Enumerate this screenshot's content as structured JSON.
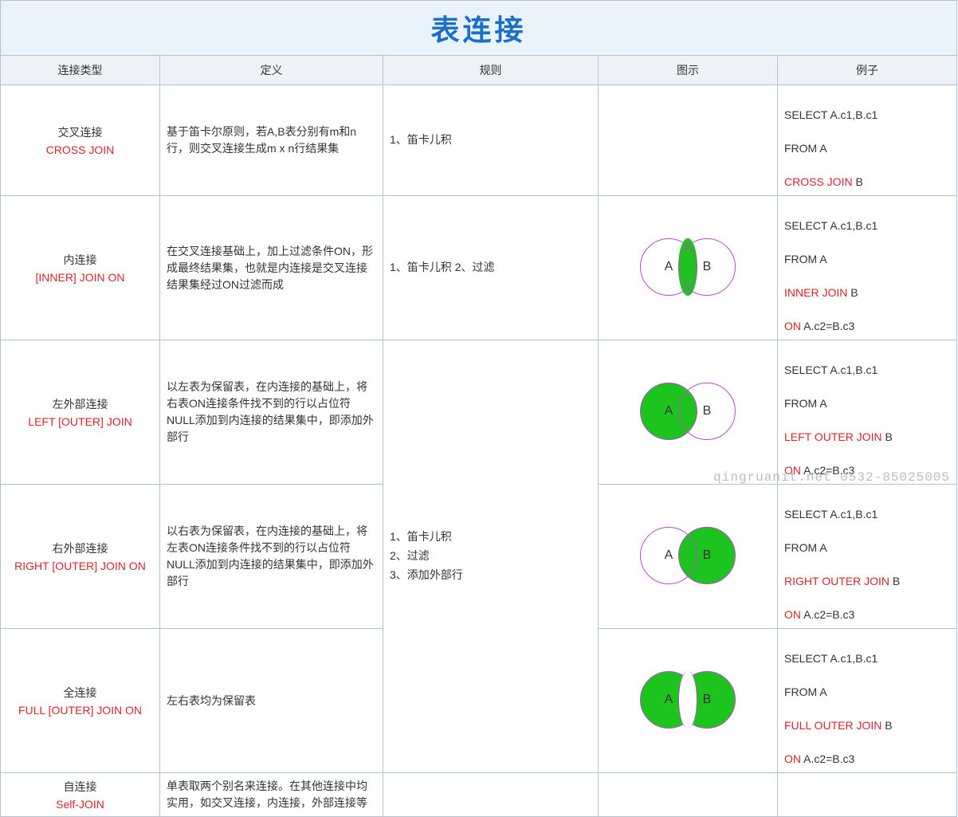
{
  "title": "表连接",
  "headers": {
    "type": "连接类型",
    "def": "定义",
    "rule": "规则",
    "venn": "图示",
    "ex": "例子"
  },
  "rows": {
    "cross": {
      "name_cn": "交叉连接",
      "name_en": "CROSS JOIN",
      "def": "基于笛卡尔原则，若A,B表分别有m和n行，则交叉连接生成m x n行结果集",
      "rule": "1、笛卡儿积",
      "ex_l1": "SELECT A.c1,B.c1",
      "ex_l2": "FROM  A",
      "ex_kw": "CROSS   JOIN",
      "ex_after_kw": " B"
    },
    "inner": {
      "name_cn": "内连接",
      "name_en": "[INNER]  JOIN  ON",
      "def": "在交叉连接基础上，加上过滤条件ON，形成最终结果集，也就是内连接是交叉连接结果集经过ON过滤而成",
      "rule": "1、笛卡儿积  2、过滤",
      "ex_l1": "SELECT A.c1,B.c1",
      "ex_l2": "FROM  A",
      "ex_kw": "INNER   JOIN",
      "ex_after_kw": " B",
      "ex_on_kw": "ON",
      "ex_on_rest": "  A.c2=B.c3"
    },
    "left": {
      "name_cn": "左外部连接",
      "name_en": "LEFT [OUTER] JOIN",
      "def": "以左表为保留表，在内连接的基础上，将右表ON连接条件找不到的行以占位符NULL添加到内连接的结果集中，即添加外部行",
      "ex_l1": "SELECT A.c1,B.c1",
      "ex_l2": "FROM  A",
      "ex_kw": "LEFT OUTER  JOIN",
      "ex_after_kw": " B",
      "ex_on_kw": "ON",
      "ex_on_rest": "  A.c2=B.c3"
    },
    "right": {
      "name_cn": "右外部连接",
      "name_en": "RIGHT [OUTER] JOIN ON",
      "def": "以右表为保留表，在内连接的基础上，将左表ON连接条件找不到的行以占位符NULL添加到内连接的结果集中，即添加外部行",
      "ex_l1": "SELECT A.c1,B.c1",
      "ex_l2": "FROM  A",
      "ex_kw": "RIGHT OUTER JOIN",
      "ex_after_kw": " B",
      "ex_on_kw": "ON",
      "ex_on_rest": "  A.c2=B.c3"
    },
    "full": {
      "name_cn": "全连接",
      "name_en": "FULL [OUTER] JOIN ON",
      "def": "左右表均为保留表",
      "ex_l1": "SELECT A.c1,B.c1",
      "ex_l2": "FROM  A",
      "ex_kw": "FULL OUTER  JOIN",
      "ex_after_kw": " B",
      "ex_on_kw": "ON",
      "ex_on_rest": "  A.c2=B.c3"
    },
    "self": {
      "name_cn": "自连接",
      "name_en": "Self-JOIN",
      "def": "单表取两个别名来连接。在其他连接中均实用，如交叉连接，内连接，外部连接等"
    }
  },
  "outer_rule": "1、笛卡儿积\n2、过滤\n3、添加外部行",
  "labels": {
    "A": "A",
    "B": "B"
  },
  "watermark": "qingruanit.net 0532-85025005"
}
